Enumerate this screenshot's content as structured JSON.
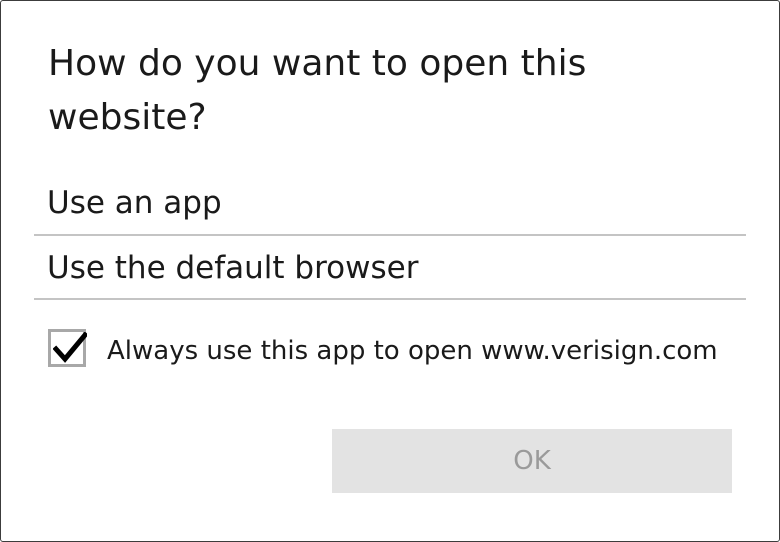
{
  "dialog": {
    "title": "How do you want to open this website?",
    "options": [
      {
        "label": "Use an app"
      },
      {
        "label": "Use the default browser"
      }
    ],
    "checkbox": {
      "label": "Always use this app to open www.verisign.com",
      "checked": true
    },
    "ok_button": {
      "label": "OK",
      "enabled": false
    }
  },
  "colors": {
    "text": "#1a1a1a",
    "divider": "#c4c4c4",
    "checkbox_border": "#a8a8a8",
    "button_disabled_bg": "#e3e3e3",
    "button_disabled_text": "#9a9a9a"
  },
  "icons": {
    "checkmark": "checkmark-icon"
  }
}
